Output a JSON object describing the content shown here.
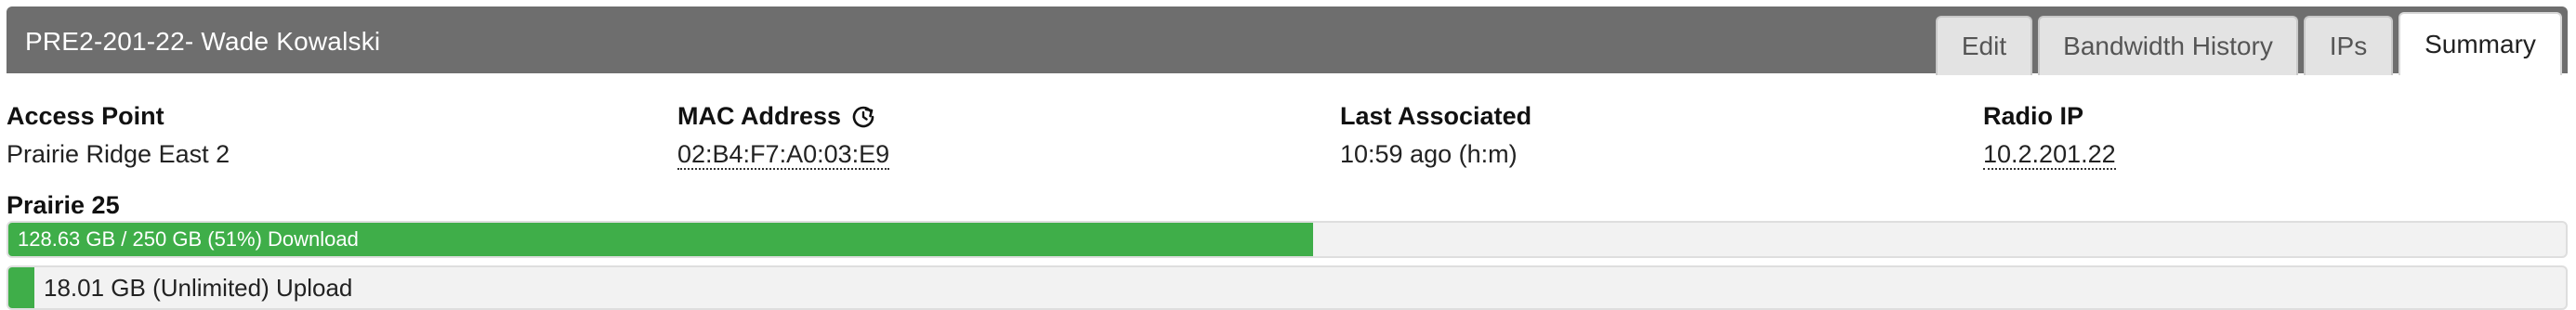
{
  "header": {
    "title": "PRE2-201-22- Wade Kowalski",
    "tabs": [
      "Edit",
      "Bandwidth History",
      "IPs",
      "Summary"
    ],
    "active_tab": "Summary",
    "bg_color": "#6e6e6e"
  },
  "info": {
    "access_point": {
      "label": "Access Point",
      "value": "Prairie Ridge East 2"
    },
    "mac_address": {
      "label": "MAC Address",
      "value": "02:B4:F7:A0:03:E9",
      "icon": "refresh-icon"
    },
    "last_associated": {
      "label": "Last Associated",
      "value": "10:59 ago (h:m)"
    },
    "radio_ip": {
      "label": "Radio IP",
      "value": "10.2.201.22"
    }
  },
  "usage": {
    "plan": "Prairie 25",
    "download": {
      "text": "128.63 GB / 250 GB (51%) Download",
      "percent": 51
    },
    "upload": {
      "text": "18.01 GB (Unlimited) Upload",
      "percent": 1
    },
    "bar_color": "#3fae49"
  }
}
